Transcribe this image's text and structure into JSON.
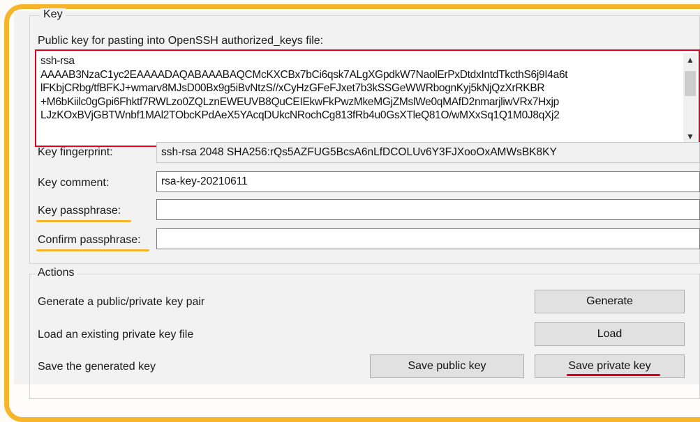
{
  "key_group": {
    "legend": "Key",
    "public_key_label": "Public key for pasting into OpenSSH authorized_keys file:",
    "public_key_lines": [
      "ssh-rsa",
      "AAAAB3NzaC1yc2EAAAADAQABAAABAQCMcKXCBx7bCi6qsk7ALgXGpdkW7NaolErPxDtdxIntdTkcthS6j9I4a6t",
      "lFKbjCRbg/tfBFKJ+wmarv8MJsD00Bx9g5iBvNtzS//xCyHzGFeFJxet7b3kSSGeWWRbognKyj5kNjQzXrRKBR",
      "+M6bKiilc0gGpi6Fhktf7RWLzo0ZQLznEWEUVB8QuCEIEkwFkPwzMkeMGjZMslWe0qMAfD2nmarjliwVRx7Hxjp",
      "LJzKOxBVjGBTWnbf1MAl2TObcKPdAeX5YAcqDUkcNRochCg813fRb4u0GsXTleQ81O/wMXxSq1Q1M0J8qXj2"
    ],
    "fingerprint_label": "Key fingerprint:",
    "fingerprint_value": "ssh-rsa 2048 SHA256:rQs5AZFUG5BcsA6nLfDCOLUv6Y3FJXooOxAMWsBK8KY",
    "comment_label": "Key comment:",
    "comment_value": "rsa-key-20210611",
    "passphrase_label": "Key passphrase:",
    "passphrase_value": "",
    "confirm_label": "Confirm passphrase:",
    "confirm_value": ""
  },
  "actions_group": {
    "legend": "Actions",
    "generate_label": "Generate a public/private key pair",
    "generate_button": "Generate",
    "load_label": "Load an existing private key file",
    "load_button": "Load",
    "save_label": "Save the generated key",
    "save_public_button": "Save public key",
    "save_private_button": "Save private key"
  },
  "colors": {
    "highlight_frame": "#f6b52a",
    "public_key_border": "#e0001b",
    "underline_passphrase": "#f6b52a",
    "underline_save_private": "#d8001b"
  },
  "icons": {
    "scroll_up": "▲",
    "scroll_down": "▼"
  }
}
